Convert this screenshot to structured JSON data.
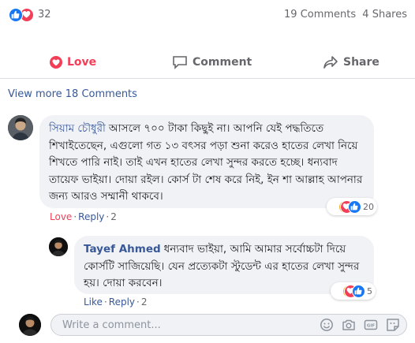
{
  "summary": {
    "reaction_count": "32",
    "comments": "19 Comments",
    "shares": "4 Shares",
    "reaction_icons": [
      "like-icon",
      "love-icon"
    ]
  },
  "actions": {
    "love_label": "Love",
    "comment_label": "Comment",
    "share_label": "Share"
  },
  "view_more": "View more 18 Comments",
  "comments": [
    {
      "author": "সিয়াম চৌধুরী",
      "text": "আসলে ৭০০ টাকা কিছুই না। আপনি যেই পদ্ধতিতে শিখাইতেছেন, এগুলো গত ১৩ বৎসর পড়া শুনা করেও হাতের লেখা নিয়ে শিখতে পারি নাই। তাই এখন হাতের লেখা সুন্দর করতে হচ্ছে। ধন্যবাদ তায়েফ ভাইয়া। দোয়া রইল। কোর্স টা শেষ করে নিই, ইন শা আল্লাহ আপনার জন্য আরও সম্মানী থাকবে।",
      "action_primary": "Love",
      "action_reply": "Reply",
      "time": "2",
      "reaction_count": "20",
      "reaction_icons": [
        "love-icon",
        "haha-icon",
        "like-icon"
      ]
    },
    {
      "author": "Tayef Ahmed",
      "text": "ধন্যবাদ ভাইয়া, আমি আমার সর্বোচ্চটা দিয়ে কোর্সটি সাজিয়েছি। যেন প্রত্যেকটা স্টুডেন্ট এর হাতের লেখা সুন্দর হয়। দোয়া করবেন।",
      "action_primary": "Like",
      "action_reply": "Reply",
      "time": "2",
      "reaction_count": "5",
      "reaction_icons": [
        "love-icon",
        "haha-icon",
        "like-icon"
      ]
    }
  ],
  "composer": {
    "placeholder": "Write a comment...",
    "tools": [
      "emoji-icon",
      "camera-icon",
      "gif-icon",
      "sticker-icon"
    ]
  },
  "colors": {
    "like_blue": "#1877f2",
    "love_red": "#f33e58",
    "haha_yellow": "#f7b125",
    "link_blue": "#385898",
    "muted": "#65676b",
    "bubble_bg": "#f0f2f5"
  }
}
